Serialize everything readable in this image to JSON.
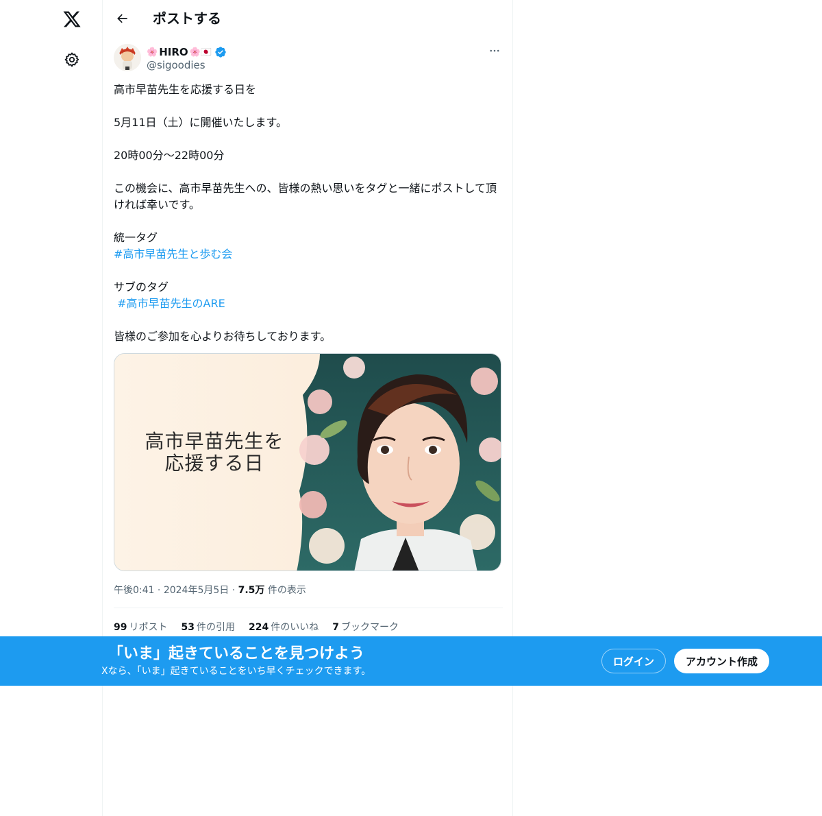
{
  "nav": {
    "logo_icon": "x-logo-icon",
    "settings_icon": "gear-icon"
  },
  "header": {
    "back_icon": "arrow-left-icon",
    "title": "ポストする"
  },
  "post": {
    "author": {
      "display_name": "HIRO",
      "name_emoji_before": "🌸",
      "name_emoji_after": "🌸🇯🇵",
      "handle": "@sigoodies",
      "verified": true
    },
    "more_icon": "more-dots-icon",
    "body": {
      "p1": "高市早苗先生を応援する日を",
      "p2": "5月11日（土）に開催いたします。",
      "p3": "20時00分〜22時00分",
      "p4": "この機会に、高市早苗先生への、皆様の熱い思いをタグと一緒にポストして頂ければ幸いです。",
      "p5_label": "統一タグ",
      "p5_tag": "#高市早苗先生と歩む会",
      "p6_label": "サブのタグ",
      "p6_tag": " #高市早苗先生のARE",
      "p7": "皆様のご参加を心よりお待ちしております。"
    },
    "media": {
      "text_line1": "高市早苗先生を",
      "text_line2": "応援する日"
    },
    "meta": {
      "time": "午後0:41",
      "sep1": " · ",
      "date": "2024年5月5日",
      "sep2": " · ",
      "views_count": "7.5万",
      "views_label": " 件の表示"
    },
    "stats": [
      {
        "count": "99",
        "label": "リポスト"
      },
      {
        "count": "53",
        "label": "件の引用"
      },
      {
        "count": "224",
        "label": "件のいいね"
      },
      {
        "count": "7",
        "label": "ブックマーク"
      }
    ]
  },
  "banner": {
    "title": "「いま」起きていることを見つけよう",
    "subtitle": "Xなら、「いま」起きていることをいち早くチェックできます。",
    "login_label": "ログイン",
    "signup_label": "アカウント作成"
  },
  "colors": {
    "accent": "#1d9bf0",
    "text": "#0f1419",
    "muted": "#536471"
  }
}
